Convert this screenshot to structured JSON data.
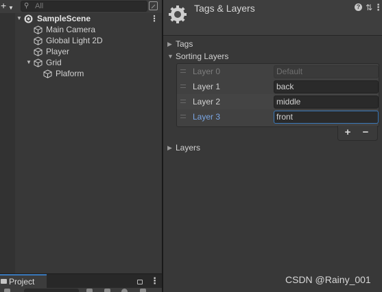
{
  "hierarchy": {
    "add_icon": "plus-icon",
    "search_placeholder": "All",
    "scene": {
      "name": "SampleScene",
      "menu": "⋮"
    },
    "items": [
      {
        "label": "Main Camera"
      },
      {
        "label": "Global Light 2D"
      },
      {
        "label": "Player"
      },
      {
        "label": "Grid"
      },
      {
        "label": "Plaform"
      }
    ]
  },
  "project": {
    "tab_label": "Project",
    "menu": "⋮"
  },
  "inspector": {
    "title": "Tags & Layers",
    "help": "?",
    "preset": "⇅",
    "menu": "⋮",
    "tags_label": "Tags",
    "sorting_layers_label": "Sorting Layers",
    "sorting_layers": [
      {
        "name": "Layer 0",
        "value": "Default"
      },
      {
        "name": "Layer 1",
        "value": "back"
      },
      {
        "name": "Layer 2",
        "value": "middle"
      },
      {
        "name": "Layer 3",
        "value": "front"
      }
    ],
    "add_label": "+",
    "remove_label": "−",
    "layers_label": "Layers"
  },
  "colors": {
    "panel_bg": "#383838",
    "field_bg": "#2a2a2a",
    "accent_blue": "#3a79bb",
    "active_text": "#7aa6e4"
  },
  "watermark": "CSDN @Rainy_001"
}
